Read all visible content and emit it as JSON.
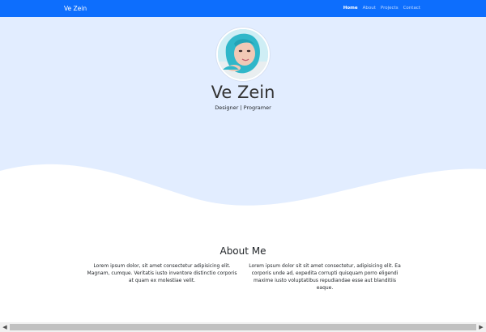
{
  "navbar": {
    "brand": "Ve Zein",
    "links": [
      {
        "label": "Home",
        "active": true
      },
      {
        "label": "About",
        "active": false
      },
      {
        "label": "Projects",
        "active": false
      },
      {
        "label": "Contact",
        "active": false
      }
    ]
  },
  "hero": {
    "name": "Ve Zein",
    "subtitle": "Designer | Programer"
  },
  "about": {
    "title": "About Me",
    "paragraphs": [
      "Lorem ipsum dolor, sit amet consectetur adipisicing elit. Magnam, cumque. Veritatis iusto inventore distinctio corporis at quam ex molestiae velit.",
      "Lorem ipsum dolor sit sit amet consectetur, adipisicing elit. Ea corporis unde ad, expedita corrupti quisquam porro eligendi maxime iusto voluptatibus repudiandae esse aut blanditiis eaque."
    ]
  },
  "scrollbar": {
    "left_arrow": "◀",
    "right_arrow": "▶"
  },
  "colors": {
    "navbar": "#0d6efd",
    "hero_bg": "#e2edff",
    "page_bg": "#ffffff"
  }
}
